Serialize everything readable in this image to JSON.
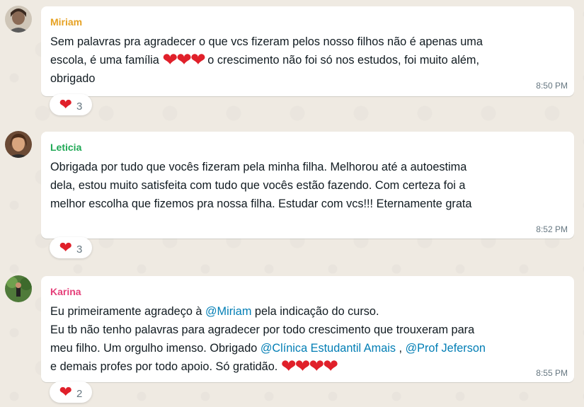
{
  "messages": [
    {
      "author": "Miriam",
      "author_color": "#e6a224",
      "segments": [
        {
          "t": "text",
          "v": "Sem palavras pra agradecer o que vcs fizeram pelos nosso filhos não é apenas uma\nescola, é uma família "
        },
        {
          "t": "emoji",
          "v": "❤❤❤"
        },
        {
          "t": "text",
          "v": " o crescimento não foi só nos estudos, foi muito além,\nobrigado"
        }
      ],
      "time": "8:50 PM",
      "reaction": {
        "emoji": "heart-icon",
        "count": "3"
      }
    },
    {
      "author": "Leticia",
      "author_color": "#1fa855",
      "segments": [
        {
          "t": "text",
          "v": "Obrigada por tudo que vocês fizeram pela minha filha. Melhorou até a autoestima\ndela, estou muito satisfeita com tudo que vocês estão fazendo. Com certeza foi a\nmelhor escolha que fizemos pra nossa filha. Estudar com vcs!!! Eternamente grata"
        }
      ],
      "time": "8:52 PM",
      "reaction": {
        "emoji": "heart-icon",
        "count": "3"
      }
    },
    {
      "author": "Karina",
      "author_color": "#e5407a",
      "segments": [
        {
          "t": "text",
          "v": "Eu primeiramente agradeço à "
        },
        {
          "t": "mention",
          "v": "@Miriam"
        },
        {
          "t": "text",
          "v": " pela indicação do curso.\nEu tb não tenho palavras para agradecer por todo crescimento que trouxeram para\nmeu filho. Um orgulho imenso. Obrigado "
        },
        {
          "t": "mention",
          "v": "@Clínica Estudantil Amais"
        },
        {
          "t": "text",
          "v": " , "
        },
        {
          "t": "mention",
          "v": "@Prof Jeferson"
        },
        {
          "t": "text",
          "v": "\ne demais profes por todo apoio. Só gratidão. "
        },
        {
          "t": "emoji",
          "v": "❤❤❤❤"
        }
      ],
      "time": "8:55 PM",
      "reaction": {
        "emoji": "heart-icon",
        "count": "2"
      }
    }
  ]
}
